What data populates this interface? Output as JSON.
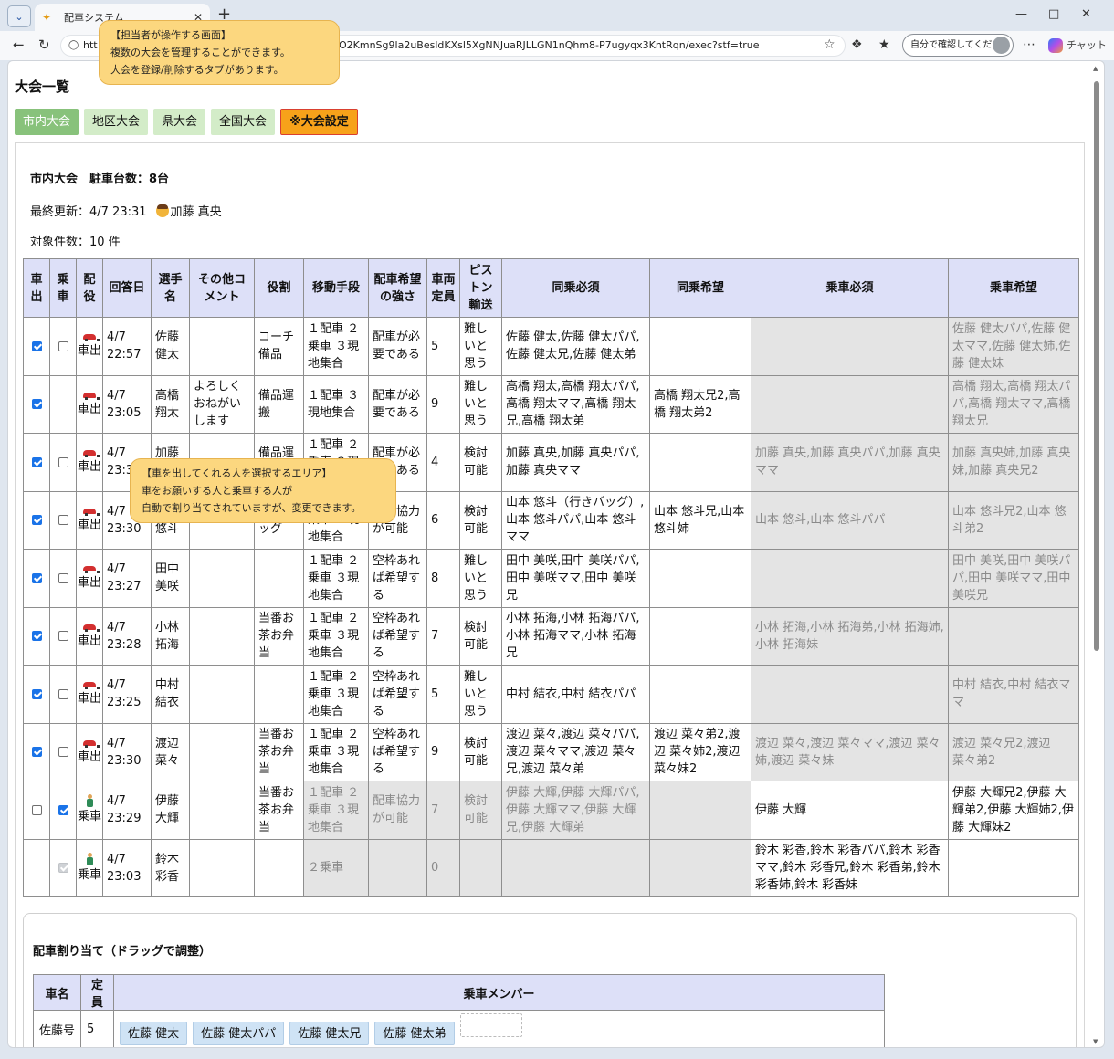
{
  "browser": {
    "tab_title": "配車システム",
    "url_start": "htt",
    "url_end": "O2KmnSg9la2uBesldKXsl5XgNNJuaRJLLGN1nQhm8-P7ugyqx3KntRqn/exec?stf=true",
    "profile_label": "自分で確認してください",
    "copilot_label": "チャット"
  },
  "page": {
    "title": "大会一覧",
    "tabs": [
      {
        "label": "市内大会",
        "active": true
      },
      {
        "label": "地区大会"
      },
      {
        "label": "県大会"
      },
      {
        "label": "全国大会"
      },
      {
        "label": "※大会設定",
        "settings": true
      }
    ],
    "heading": "市内大会　駐車台数：8台",
    "last_updated": "最終更新：4/7 23:31",
    "updated_by": "加藤 真央",
    "count": "対象件数：10 件"
  },
  "table": {
    "headers": [
      "車出",
      "乗車",
      "配役",
      "回答日",
      "選手名",
      "その他コメント",
      "役割",
      "移動手段",
      "配車希望の強さ",
      "車両定員",
      "ピストン輸送",
      "同乗必須",
      "同乗希望",
      "乗車必須",
      "乗車希望"
    ],
    "rows": [
      {
        "driver": true,
        "ride": false,
        "role": "car",
        "role_label": "車出",
        "date": "4/7 22:57",
        "name": "佐藤 健太",
        "comment": "",
        "duty": "コーチ備品",
        "transport": "１配車 ２乗車 ３現地集合",
        "strength": "配車が必要である",
        "capacity": "5",
        "piston": "難しいと思う",
        "co_req": "佐藤 健太,佐藤 健太パパ,佐藤 健太兄,佐藤 健太弟",
        "co_pref": "",
        "ride_req": "",
        "ride_pref": "佐藤 健太パパ,佐藤 健太ママ,佐藤 健太姉,佐藤 健太妹"
      },
      {
        "driver": true,
        "ride": null,
        "role": "car",
        "role_label": "車出",
        "date": "4/7 23:05",
        "name": "高橋 翔太",
        "comment": "よろしくおねがいします",
        "duty": "備品運搬",
        "transport": "１配車 ３現地集合",
        "strength": "配車が必要である",
        "capacity": "9",
        "piston": "難しいと思う",
        "co_req": "高橋 翔太,高橋 翔太パパ,高橋 翔太ママ,高橋 翔太兄,高橋 翔太弟",
        "co_pref": "高橋 翔太兄2,高橋 翔太弟2",
        "ride_req": "",
        "ride_pref": "高橋 翔太,高橋 翔太パパ,高橋 翔太ママ,高橋 翔太兄"
      },
      {
        "driver": true,
        "ride": false,
        "role": "car",
        "role_label": "車出",
        "date": "4/7 23:31",
        "name": "加藤 真央",
        "comment": "",
        "duty": "備品運搬",
        "transport": "１配車 ２乗車 ３現地集合",
        "strength": "配車が必要である",
        "capacity": "4",
        "piston": "検討可能",
        "co_req": "加藤 真央,加藤 真央パパ,加藤 真央ママ",
        "co_pref": "",
        "ride_req": "加藤 真央,加藤 真央パパ,加藤 真央ママ",
        "ride_pref": "加藤 真央姉,加藤 真央妹,加藤 真央兄2"
      },
      {
        "driver": true,
        "ride": false,
        "role": "car",
        "role_label": "車出",
        "date": "4/7 23:30",
        "name": "山本 悠斗",
        "comment": "",
        "duty": "行きバッグ",
        "transport": "１配車 ２乗車 ３現地集合",
        "strength": "配車協力が可能",
        "capacity": "6",
        "piston": "検討可能",
        "co_req": "山本 悠斗（行きバッグ）,山本 悠斗パパ,山本 悠斗ママ",
        "co_pref": "山本 悠斗兄,山本 悠斗姉",
        "ride_req": "山本 悠斗,山本 悠斗パパ",
        "ride_pref": "山本 悠斗兄2,山本 悠斗弟2"
      },
      {
        "driver": true,
        "ride": false,
        "role": "car",
        "role_label": "車出",
        "date": "4/7 23:27",
        "name": "田中 美咲",
        "comment": "",
        "duty": "",
        "transport": "１配車 ２乗車 ３現地集合",
        "strength": "空枠あれば希望する",
        "capacity": "8",
        "piston": "難しいと思う",
        "co_req": "田中 美咲,田中 美咲パパ,田中 美咲ママ,田中 美咲兄",
        "co_pref": "",
        "ride_req": "",
        "ride_pref": "田中 美咲,田中 美咲パパ,田中 美咲ママ,田中 美咲兄"
      },
      {
        "driver": true,
        "ride": false,
        "role": "car",
        "role_label": "車出",
        "date": "4/7 23:28",
        "name": "小林 拓海",
        "comment": "",
        "duty": "当番お茶お弁当",
        "transport": "１配車 ２乗車 ３現地集合",
        "strength": "空枠あれば希望する",
        "capacity": "7",
        "piston": "検討可能",
        "co_req": "小林 拓海,小林 拓海パパ,小林 拓海ママ,小林 拓海兄",
        "co_pref": "",
        "ride_req": "小林 拓海,小林 拓海弟,小林 拓海姉,小林 拓海妹",
        "ride_pref": ""
      },
      {
        "driver": true,
        "ride": false,
        "role": "car",
        "role_label": "車出",
        "date": "4/7 23:25",
        "name": "中村 結衣",
        "comment": "",
        "duty": "",
        "transport": "１配車 ２乗車 ３現地集合",
        "strength": "空枠あれば希望する",
        "capacity": "5",
        "piston": "難しいと思う",
        "co_req": "中村 結衣,中村 結衣パパ",
        "co_pref": "",
        "ride_req": "",
        "ride_pref": "中村 結衣,中村 結衣ママ"
      },
      {
        "driver": true,
        "ride": false,
        "role": "car",
        "role_label": "車出",
        "date": "4/7 23:30",
        "name": "渡辺 菜々",
        "comment": "",
        "duty": "当番お茶お弁当",
        "transport": "１配車 ２乗車 ３現地集合",
        "strength": "空枠あれば希望する",
        "capacity": "9",
        "piston": "検討可能",
        "co_req": "渡辺 菜々,渡辺 菜々パパ,渡辺 菜々ママ,渡辺 菜々兄,渡辺 菜々弟",
        "co_pref": "渡辺 菜々弟2,渡辺 菜々姉2,渡辺 菜々妹2",
        "ride_req": "渡辺 菜々,渡辺 菜々ママ,渡辺 菜々姉,渡辺 菜々妹",
        "ride_pref": "渡辺 菜々兄2,渡辺 菜々弟2"
      },
      {
        "driver": false,
        "ride": true,
        "role": "walk",
        "role_label": "乗車",
        "date": "4/7 23:29",
        "name": "伊藤 大輝",
        "comment": "",
        "duty": "当番お茶お弁当",
        "transport": "１配車 ２乗車 ３現地集合",
        "strength": "配車協力が可能",
        "capacity": "7",
        "piston": "検討可能",
        "co_req": "伊藤 大輝,伊藤 大輝パパ,伊藤 大輝ママ,伊藤 大輝兄,伊藤 大輝弟",
        "co_pref": "",
        "ride_req": "伊藤 大輝",
        "ride_pref": "伊藤 大輝兄2,伊藤 大輝弟2,伊藤 大輝姉2,伊藤 大輝妹2",
        "grey_mid": true
      },
      {
        "driver": null,
        "ride": "disabled",
        "role": "walk",
        "role_label": "乗車",
        "date": "4/7 23:03",
        "name": "鈴木 彩香",
        "comment": "",
        "duty": "",
        "transport": "２乗車",
        "strength": "",
        "capacity": "0",
        "piston": "",
        "co_req": "",
        "co_pref": "",
        "ride_req": "鈴木 彩香,鈴木 彩香パパ,鈴木 彩香ママ,鈴木 彩香兄,鈴木 彩香弟,鈴木 彩香姉,鈴木 彩香妹",
        "ride_pref": "",
        "grey_mid": true
      }
    ]
  },
  "assign": {
    "title": "配車割り当て（ドラッグで調整）",
    "headers": [
      "車名",
      "定員",
      "乗車メンバー"
    ],
    "rows": [
      {
        "car": "佐藤号",
        "cap": "5",
        "members": [
          "佐藤 健太",
          "佐藤 健太パパ",
          "佐藤 健太兄",
          "佐藤 健太弟"
        ]
      }
    ]
  },
  "callouts": {
    "top": {
      "title": "【担当者が操作する画面】",
      "line1": "複数の大会を管理することができます。",
      "line2": "大会を登録/削除するタブがあります。"
    },
    "mid": {
      "title": "【車を出してくれる人を選択するエリア】",
      "line1": "車をお願いする人と乗車する人が",
      "line2": "自動で割り当てされていますが、変更できます。"
    }
  }
}
